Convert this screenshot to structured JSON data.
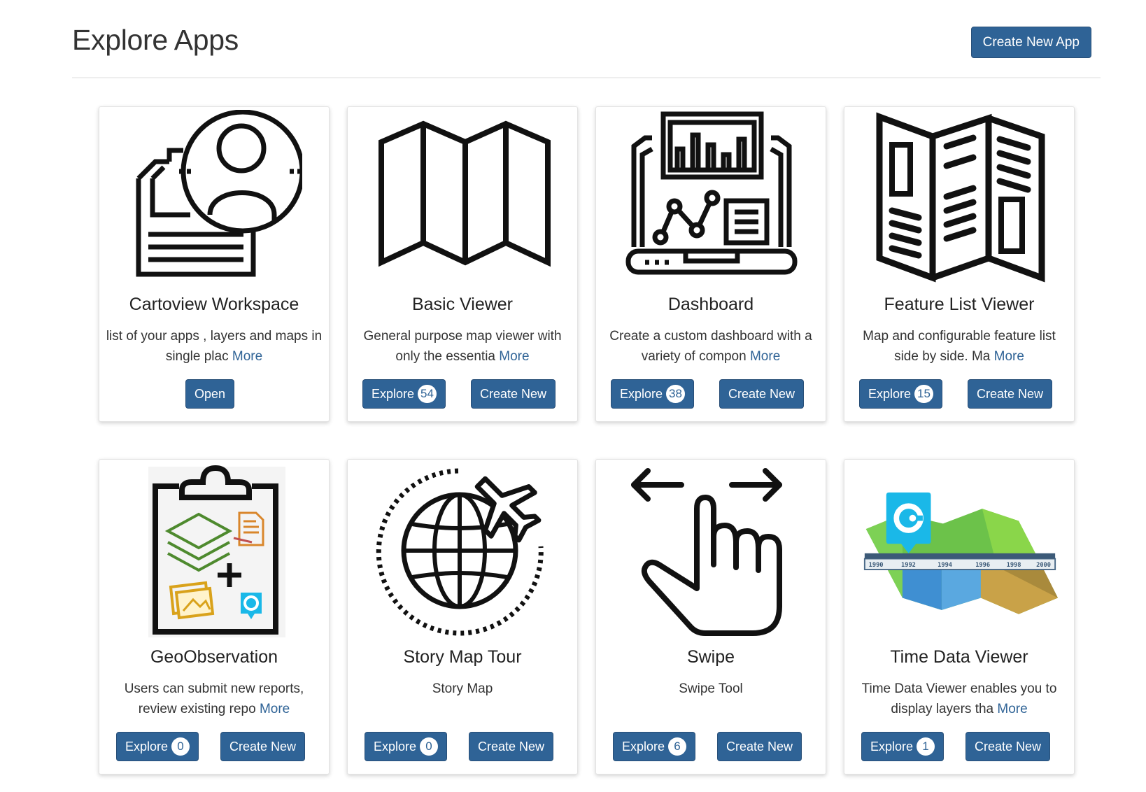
{
  "header": {
    "title": "Explore Apps",
    "create_button_label": "Create New App"
  },
  "colors": {
    "primary_button": "#2f6396",
    "link": "#2f6396"
  },
  "apps": [
    {
      "name": "Cartoview Workspace",
      "icon": "workspace-icon",
      "description": "list of your apps , layers and maps in single plac",
      "more_label": "More",
      "open_label": "Open"
    },
    {
      "name": "Basic Viewer",
      "icon": "folded-map-icon",
      "description": "General purpose map viewer with only the essentia",
      "more_label": "More",
      "explore_label": "Explore",
      "explore_count": "54",
      "create_label": "Create New"
    },
    {
      "name": "Dashboard",
      "icon": "dashboard-icon",
      "description": "Create a custom dashboard with a variety of compon",
      "more_label": "More",
      "explore_label": "Explore",
      "explore_count": "38",
      "create_label": "Create New"
    },
    {
      "name": "Feature List Viewer",
      "icon": "brochure-list-icon",
      "description": "Map and configurable feature list side by side. Ma",
      "more_label": "More",
      "explore_label": "Explore",
      "explore_count": "15",
      "create_label": "Create New"
    },
    {
      "name": "GeoObservation",
      "icon": "clipboard-observation-icon",
      "description": "Users can submit new reports, review existing repo",
      "more_label": "More",
      "explore_label": "Explore",
      "explore_count": "0",
      "create_label": "Create New"
    },
    {
      "name": "Story Map Tour",
      "icon": "globe-airplane-icon",
      "description": "Story Map",
      "more_label": "",
      "explore_label": "Explore",
      "explore_count": "0",
      "create_label": "Create New"
    },
    {
      "name": "Swipe",
      "icon": "swipe-hand-icon",
      "description": "Swipe Tool",
      "more_label": "",
      "explore_label": "Explore",
      "explore_count": "6",
      "create_label": "Create New"
    },
    {
      "name": "Time Data Viewer",
      "icon": "time-map-icon",
      "description": "Time Data Viewer enables you to display layers tha",
      "more_label": "More",
      "explore_label": "Explore",
      "explore_count": "1",
      "create_label": "Create New",
      "timeline_years": [
        "1990",
        "1992",
        "1994",
        "1996",
        "1998",
        "2000"
      ]
    }
  ]
}
